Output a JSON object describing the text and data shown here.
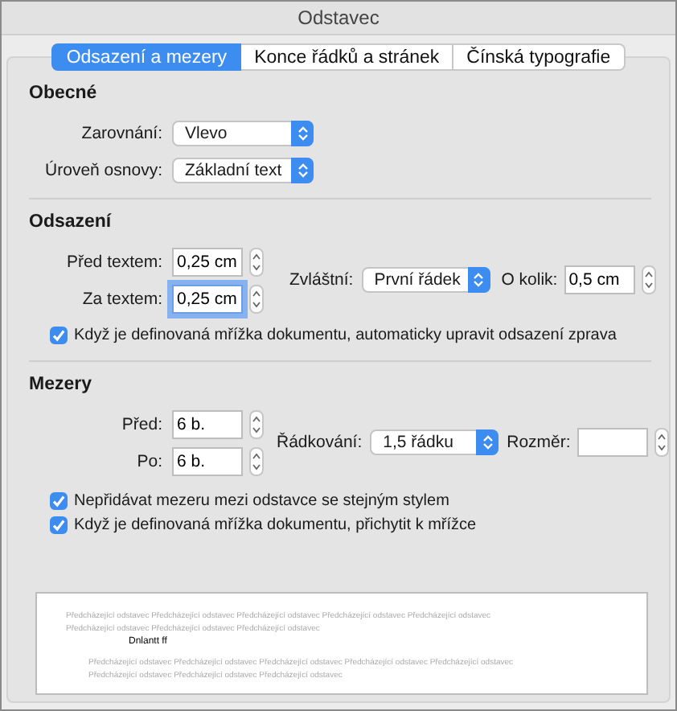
{
  "window": {
    "title": "Odstavec"
  },
  "tabs": [
    {
      "label": "Odsazení a mezery",
      "selected": true
    },
    {
      "label": "Konce řádků a stránek",
      "selected": false
    },
    {
      "label": "Čínská typografie",
      "selected": false
    }
  ],
  "general": {
    "heading": "Obecné",
    "selects": [
      {
        "label": "Zarovnání:",
        "value": "Vlevo"
      },
      {
        "label": "Úroveň osnovy:",
        "value": "Základní text"
      }
    ]
  },
  "indentation": {
    "heading": "Odsazení",
    "fields": [
      {
        "label": "Před textem:",
        "value": "0,25 cm",
        "focused": false
      },
      {
        "label": "Za textem:",
        "value": "0,25 cm",
        "focused": true
      }
    ],
    "special": {
      "label": "Zvláštní:",
      "value": "První řádek"
    },
    "by": {
      "label": "O kolik:",
      "value": "0,5 cm"
    },
    "checkboxes": [
      {
        "label": "Když je definovaná mřížka dokumentu, automaticky upravit odsazení zprava",
        "checked": true
      }
    ]
  },
  "spacing": {
    "heading": "Mezery",
    "fields": [
      {
        "label": "Před:",
        "value": "6 b.",
        "focused": false
      },
      {
        "label": "Po:",
        "value": "6 b.",
        "focused": false
      }
    ],
    "line_spacing": {
      "label": "Řádkování:",
      "value": "1,5 řádku"
    },
    "size": {
      "label": "Rozměr:"
    },
    "checkboxes": [
      {
        "label": "Nepřidávat mezeru mezi odstavce se stejným stylem",
        "checked": true
      },
      {
        "label": "Když je definovaná mřížka dokumentu, přichytit k mřížce",
        "checked": true
      }
    ]
  },
  "preview": {
    "previous_lines": [
      "Předcházející odstavec Předcházející odstavec Předcházející odstavec Předcházející odstavec Předcházející odstavec",
      "Předcházející odstavec Předcházející odstavec Předcházející odstavec"
    ],
    "sample": "Dnlantt ff",
    "following_lines": [
      "Předcházející odstavec Předcházející odstavec Předcházející odstavec Předcházející odstavec Předcházející odstavec",
      "Předcházející odstavec Předcházející odstavec Předcházející odstavec"
    ]
  }
}
